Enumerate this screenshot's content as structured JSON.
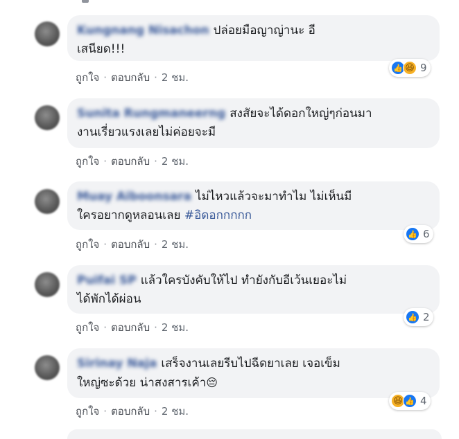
{
  "comments": [
    {
      "author": "Kungnang Nisachon",
      "text_line1": "ปล่อยมือญาญ่านะ อี",
      "text_line2": "เสนียด!!!",
      "like_label": "ถูกใจ",
      "reply_label": "ตอบกลับ",
      "time": "2 ชม.",
      "reactions": [
        "like-icon",
        "haha-icon"
      ],
      "reaction_count": "9"
    },
    {
      "author": "Sunita Rungmaneerng",
      "text_line1": "สงสัยจะได้ดอกใหญ่ๆก่อนมา",
      "text_line2": "งานเรี่ยวแรงเลยไม่ค่อยจะมี",
      "like_label": "ถูกใจ",
      "reply_label": "ตอบกลับ",
      "time": "2 ชม."
    },
    {
      "author": "Muay Aiboonsara",
      "text_line1": "ไม่ไหวแล้วจะมาทำไม ไม่เห็นมี",
      "text_line2": "ใครอยากดูหลอนเลย",
      "hashtag": "#อิดอกกกกก",
      "like_label": "ถูกใจ",
      "reply_label": "ตอบกลับ",
      "time": "2 ชม.",
      "reactions": [
        "like-icon"
      ],
      "reaction_count": "6"
    },
    {
      "author": "Puifai SP",
      "text_line1": "แล้วใครบังคับให้ไป ทำยังกับอีเว้นเยอะไม่",
      "text_line2": "ได้พักได้ผ่อน",
      "like_label": "ถูกใจ",
      "reply_label": "ตอบกลับ",
      "time": "2 ชม.",
      "reactions": [
        "like-icon"
      ],
      "reaction_count": "2"
    },
    {
      "author": "Sirinay Naja",
      "text_line1": "เสร็จงานเลยรีบไปฉีดยาเลย เจอเข็ม",
      "text_line2": "ใหญ่ซะด้วย น่าสงสารเค้า",
      "emoji": "😔",
      "like_label": "ถูกใจ",
      "reply_label": "ตอบกลับ",
      "time": "2 ชม.",
      "reactions": [
        "haha-icon",
        "like-icon"
      ],
      "reaction_count": "4"
    }
  ],
  "separator": "·",
  "colors": {
    "link": "#385898",
    "bubble": "#f2f3f5",
    "like": "#1877f2",
    "haha": "#f7b125"
  }
}
